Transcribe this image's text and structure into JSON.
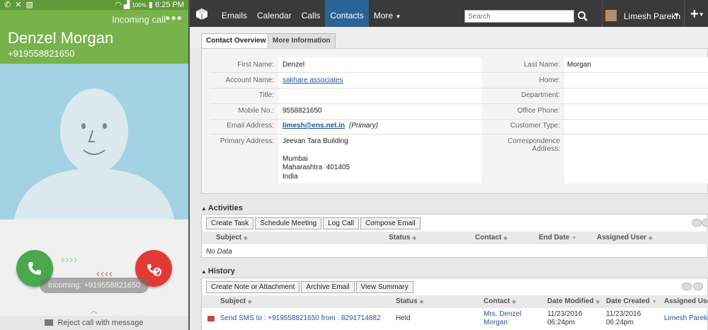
{
  "phone": {
    "status_time": "6:25 PM",
    "battery": "100%",
    "call_state": "Incoming call",
    "caller_name": "Denzel Morgan",
    "caller_number": "+919558821650",
    "incoming_pill": "Incoming: +919558821650",
    "reject_message": "Reject call with message",
    "colors": {
      "header": "#77b34a",
      "answer": "#4aa84c",
      "reject": "#e23b35",
      "avatar_bg": "#a3d3e3"
    }
  },
  "crm": {
    "nav": {
      "tabs": [
        "Emails",
        "Calendar",
        "Calls",
        "Contacts",
        "More"
      ],
      "active_tab": "Contacts",
      "search_placeholder": "Search",
      "user_name": "Limesh Parekh"
    },
    "subtabs": [
      "Contact Overview",
      "More Information"
    ],
    "detail": {
      "first_name_label": "First Name:",
      "first_name": "Denzel",
      "last_name_label": "Last Name:",
      "last_name": "Morgan",
      "account_name_label": "Account Name:",
      "account_name": "sakhare associates",
      "home_label": "Home:",
      "title_label": "Title:",
      "department_label": "Department:",
      "mobile_label": "Mobile No.:",
      "mobile": "9558821650",
      "office_phone_label": "Office Phone:",
      "email_label": "Email Address:",
      "email": "limesh@ens.net.in",
      "email_primary": "(Primary)",
      "customer_type_label": "Customer Type:",
      "primary_address_label": "Primary Address:",
      "address_line1": "Jeevan Tara Building",
      "address_city": "Mumbai",
      "address_state": "Maharashtra  401405",
      "address_country": "India",
      "correspondence_label": "Correspondence Address:"
    },
    "activities": {
      "title": "Activities",
      "buttons": [
        "Create Task",
        "Schedule Meeting",
        "Log Call",
        "Compose Email"
      ],
      "columns": [
        "Subject",
        "Status",
        "Contact",
        "End Date",
        "Assigned User"
      ],
      "empty": "No Data"
    },
    "history": {
      "title": "History",
      "buttons": [
        "Create Note or Attachment",
        "Archive Email",
        "View Summary"
      ],
      "columns": [
        "Subject",
        "Status",
        "Contact",
        "Date Modified",
        "Date Created",
        "Assigned User"
      ],
      "row": {
        "subject": "Send SMS to : +919558821650 from : 8291714882",
        "status": "Held",
        "contact_line1": "Mrs. Denzel",
        "contact_line2": "Morgan",
        "date_modified_1": "11/23/2016",
        "date_modified_2": "06:24pm",
        "date_created_1": "11/23/2016",
        "date_created_2": "06:24pm",
        "assigned_user": "Limesh Parekh"
      }
    }
  }
}
